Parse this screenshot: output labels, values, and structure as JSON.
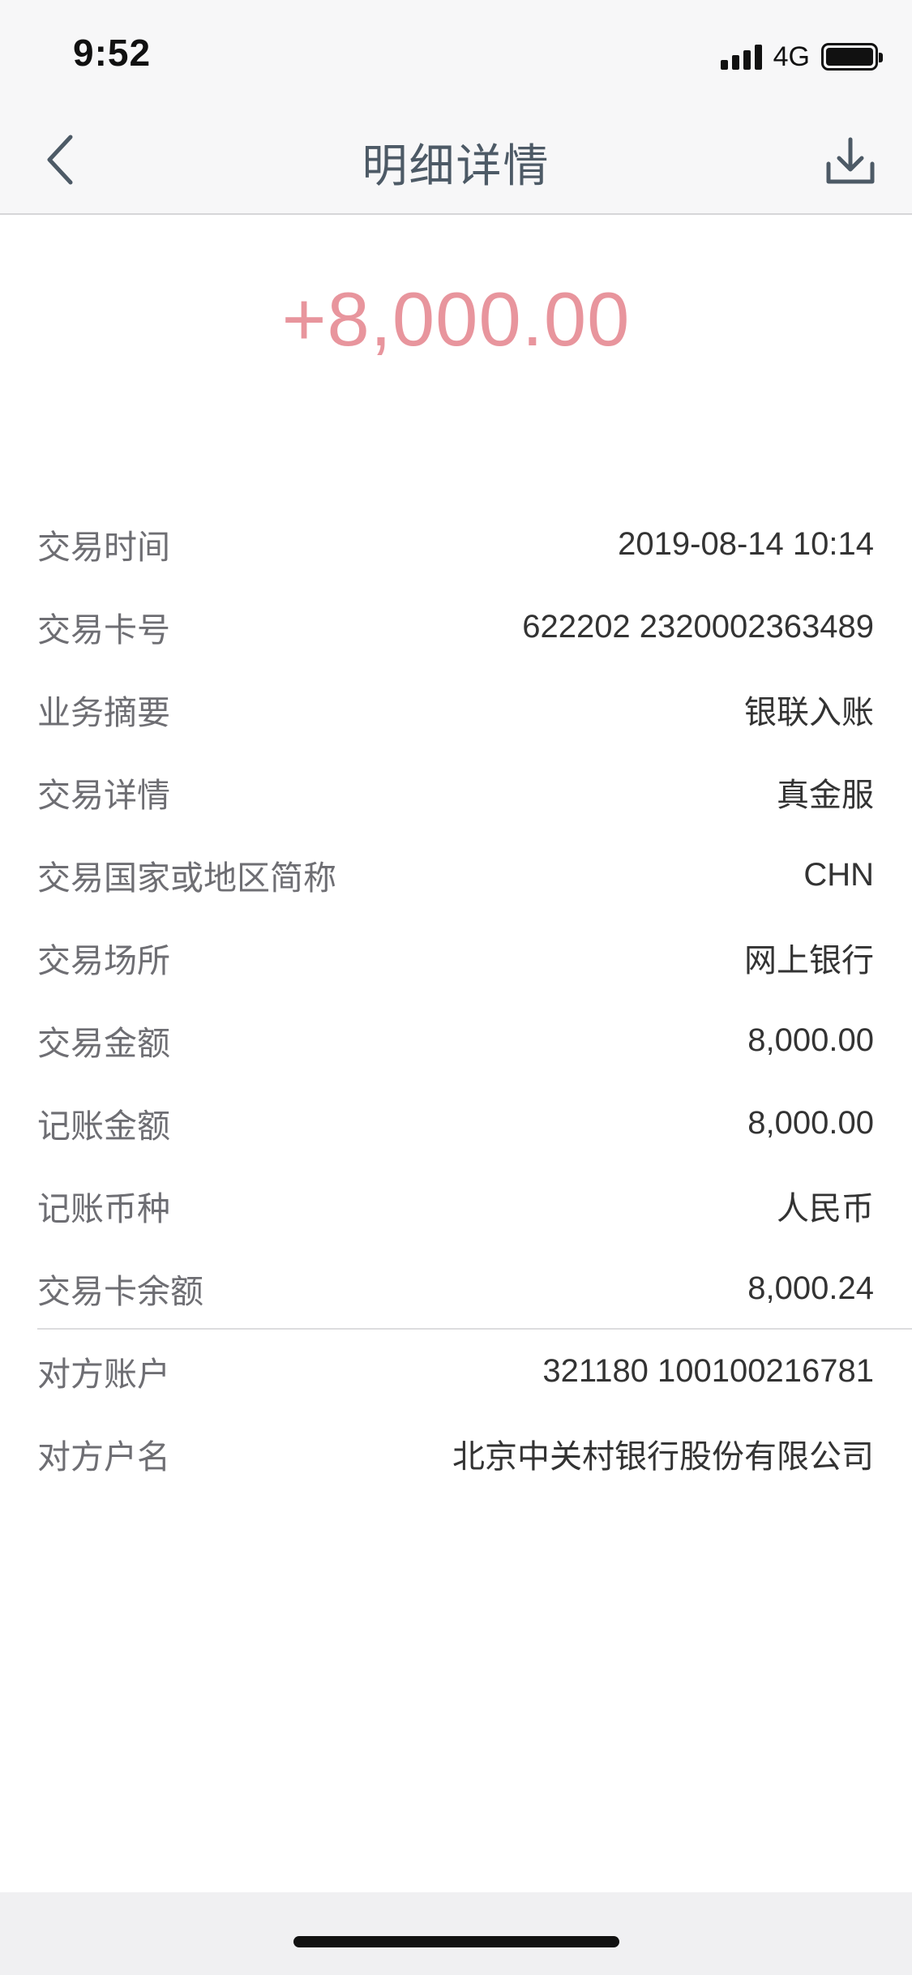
{
  "status_bar": {
    "time": "9:52",
    "network": "4G"
  },
  "nav": {
    "title": "明细详情",
    "back_icon": "chevron-left-icon",
    "download_icon": "download-icon"
  },
  "amount": "+8,000.00",
  "colors": {
    "amount": "#e8959d",
    "title": "#4d5a66",
    "label": "#6e6e73",
    "value": "#333333"
  },
  "details": [
    {
      "label": "交易时间",
      "value": "2019-08-14 10:14"
    },
    {
      "label": "交易卡号",
      "value": "622202 2320002363489"
    },
    {
      "label": "业务摘要",
      "value": "银联入账"
    },
    {
      "label": "交易详情",
      "value": "真金服"
    },
    {
      "label": "交易国家或地区简称",
      "value": "CHN"
    },
    {
      "label": "交易场所",
      "value": "网上银行"
    },
    {
      "label": "交易金额",
      "value": "8,000.00"
    },
    {
      "label": "记账金额",
      "value": "8,000.00"
    },
    {
      "label": "记账币种",
      "value": "人民币"
    },
    {
      "label": "交易卡余额",
      "value": "8,000.24"
    },
    {
      "label": "对方账户",
      "value": "321180 100100216781"
    },
    {
      "label": "对方户名",
      "value": "北京中关村银行股份有限公司"
    }
  ]
}
